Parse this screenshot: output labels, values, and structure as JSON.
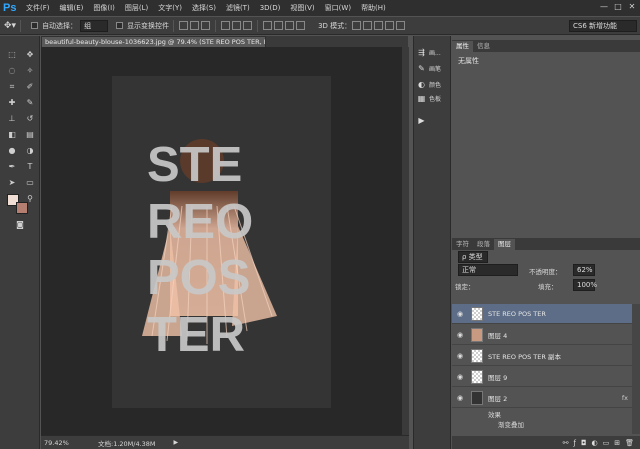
{
  "app": {
    "logo": "Ps"
  },
  "menu": [
    "文件(F)",
    "编辑(E)",
    "图像(I)",
    "图层(L)",
    "文字(Y)",
    "选择(S)",
    "滤镜(T)",
    "3D(D)",
    "视图(V)",
    "窗口(W)",
    "帮助(H)"
  ],
  "window_controls": [
    "—",
    "□",
    "✕"
  ],
  "options": {
    "auto_select_label": "自动选择：",
    "auto_select_value": "组",
    "show_transform_label": "显示变换控件",
    "mode_3d_label": "3D 模式：",
    "workspace": "CS6 新增功能"
  },
  "document": {
    "tab_title": "beautiful-beauty-blouse-1036623.jpg @ 79.4% (STE REO  POS TER, RGB/8) *",
    "poster_rows": [
      "STE",
      "REO",
      "POS",
      "TER"
    ]
  },
  "status": {
    "zoom": "79.42%",
    "doc_info": "文档:1.20M/4.38M"
  },
  "dock": [
    {
      "icon": "⇶",
      "label": "画..."
    },
    {
      "icon": "✎",
      "label": "画笔"
    },
    {
      "icon": "◐",
      "label": "颜色"
    },
    {
      "icon": "▦",
      "label": "色板"
    },
    {
      "icon": "▶",
      "label": ""
    }
  ],
  "properties": {
    "tabs": [
      "属性",
      "信息"
    ],
    "empty_text": "无属性"
  },
  "layers_panel": {
    "tabs": [
      "字符",
      "段落",
      "图层"
    ],
    "filter_label": "ρ 类型",
    "blend_mode": "正常",
    "opacity_label": "不透明度：",
    "opacity_value": "62%",
    "lock_label": "锁定：",
    "fill_label": "填充：",
    "fill_value": "100%",
    "layers": [
      {
        "name": "STE REO  POS TER",
        "selected": true
      },
      {
        "name": "图层 4",
        "selected": false
      },
      {
        "name": "STE REO  POS TER 副本",
        "selected": false
      },
      {
        "name": "图层 9",
        "selected": false
      },
      {
        "name": "图层 2",
        "selected": false
      }
    ],
    "effects_label": "效果",
    "effect_item": "渐变叠加",
    "fx_label": "fx"
  }
}
